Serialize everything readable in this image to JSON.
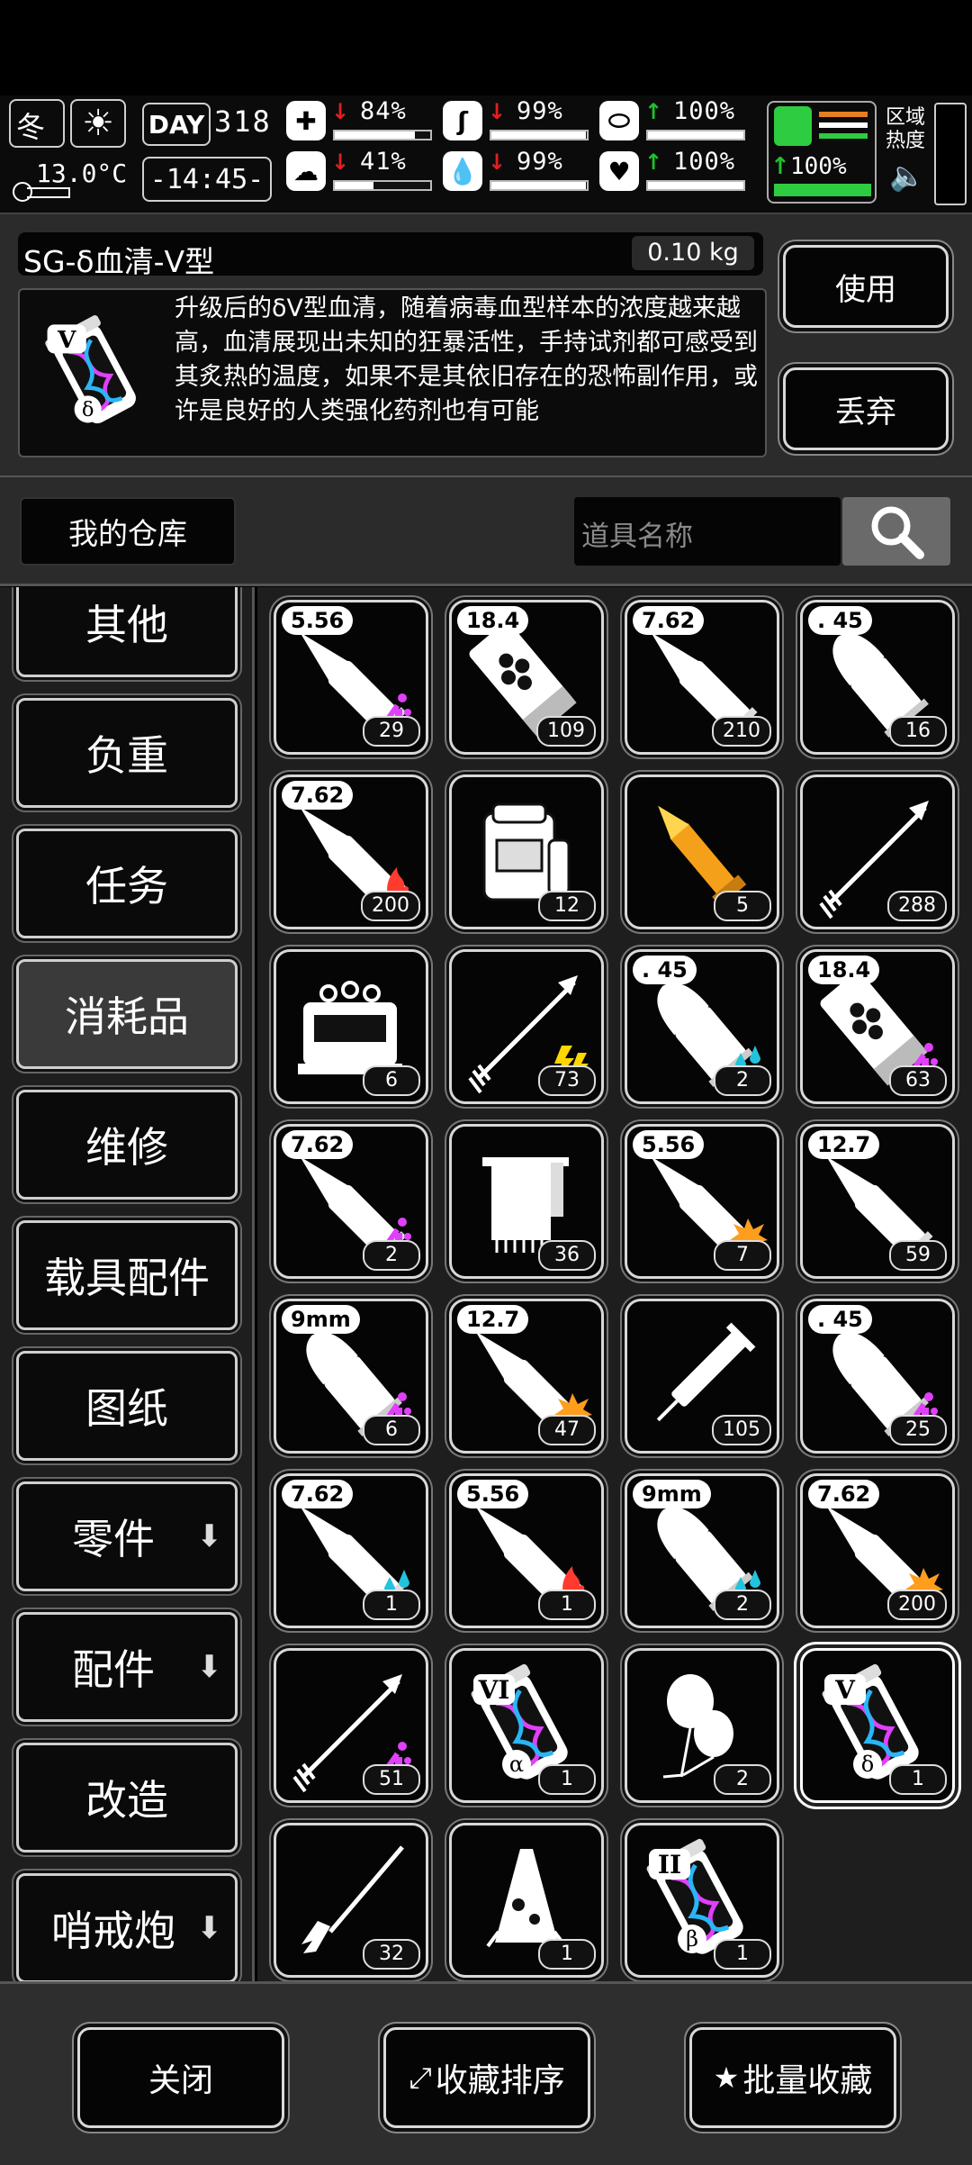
{
  "status_bar": {
    "season": "冬",
    "day_label": "DAY",
    "day_number": "318",
    "temperature": "13.0°C",
    "clock": "-14:45-",
    "stats": [
      {
        "name": "medical",
        "icon": "medkit-icon",
        "trend": "down",
        "value": "84%",
        "level": 0.84
      },
      {
        "name": "hunger",
        "icon": "stomach-icon",
        "trend": "down",
        "value": "99%",
        "level": 0.99
      },
      {
        "name": "vitamins",
        "icon": "pill-icon",
        "trend": "up",
        "value": "100%",
        "level": 1.0
      },
      {
        "name": "mood",
        "icon": "brain-icon",
        "trend": "down",
        "value": "41%",
        "level": 0.41
      },
      {
        "name": "thirst",
        "icon": "water-drop-icon",
        "trend": "down",
        "value": "99%",
        "level": 0.99
      },
      {
        "name": "health",
        "icon": "heart-icon",
        "trend": "up",
        "value": "100%",
        "level": 1.0
      }
    ],
    "stamina": {
      "trend": "up",
      "value": "100%",
      "level": 1.0
    },
    "area_heat_label": "区域\n热度",
    "colors": {
      "down": "#e0201f",
      "up": "#1ec22b",
      "stamina": "#2ecc40"
    }
  },
  "item_detail": {
    "name": "SG-δ血清-V型",
    "weight": "0.10 kg",
    "description": "升级后的δV型血清，随着病毒血型样本的浓度越来越高，血清展现出未知的狂暴活性，手持试剂都可感受到其炙热的温度，如果不是其依旧存在的恐怖副作用，或许是良好的人类强化药剂也有可能",
    "icon_badge": "V",
    "icon_greek": "δ",
    "use_label": "使用",
    "discard_label": "丢弃"
  },
  "storage": {
    "title": "我的仓库",
    "search_placeholder": "道具名称"
  },
  "categories": [
    {
      "label": "其他",
      "active": false,
      "has_arrow": false
    },
    {
      "label": "负重",
      "active": false,
      "has_arrow": false
    },
    {
      "label": "任务",
      "active": false,
      "has_arrow": false
    },
    {
      "label": "消耗品",
      "active": true,
      "has_arrow": false
    },
    {
      "label": "维修",
      "active": false,
      "has_arrow": false
    },
    {
      "label": "载具配件",
      "active": false,
      "has_arrow": false
    },
    {
      "label": "图纸",
      "active": false,
      "has_arrow": false
    },
    {
      "label": "零件",
      "active": false,
      "has_arrow": true
    },
    {
      "label": "配件",
      "active": false,
      "has_arrow": true
    },
    {
      "label": "改造",
      "active": false,
      "has_arrow": false
    },
    {
      "label": "哨戒炮",
      "active": false,
      "has_arrow": true
    }
  ],
  "items": [
    {
      "icon": "rifle-bullet-icon",
      "caliber": "5.56",
      "mod": "poison",
      "qty": "29"
    },
    {
      "icon": "shotgun-shell-icon",
      "caliber": "18.4",
      "mod": "",
      "qty": "109"
    },
    {
      "icon": "rifle-bullet-icon",
      "caliber": "7.62",
      "mod": "",
      "qty": "210"
    },
    {
      "icon": "pistol-bullet-icon",
      "caliber": ". 45",
      "mod": "",
      "qty": "16"
    },
    {
      "icon": "rifle-bullet-icon",
      "caliber": "7.62",
      "mod": "fire",
      "qty": "200"
    },
    {
      "icon": "backpack-icon",
      "caliber": "",
      "mod": "",
      "qty": "12"
    },
    {
      "icon": "rocket-icon",
      "caliber": "",
      "mod": "",
      "qty": "5"
    },
    {
      "icon": "arrow-icon",
      "caliber": "",
      "mod": "",
      "qty": "288"
    },
    {
      "icon": "machine-icon",
      "caliber": "",
      "mod": "",
      "qty": "6"
    },
    {
      "icon": "arrow-icon",
      "caliber": "",
      "mod": "shock",
      "qty": "73"
    },
    {
      "icon": "pistol-bullet-icon",
      "caliber": ". 45",
      "mod": "water",
      "qty": "2"
    },
    {
      "icon": "shotgun-shell-icon",
      "caliber": "18.4",
      "mod": "poison",
      "qty": "63"
    },
    {
      "icon": "rifle-bullet-icon",
      "caliber": "7.62",
      "mod": "poison",
      "qty": "2"
    },
    {
      "icon": "towel-icon",
      "caliber": "",
      "mod": "",
      "qty": "36"
    },
    {
      "icon": "rifle-bullet-icon",
      "caliber": "5.56",
      "mod": "explosive",
      "qty": "7"
    },
    {
      "icon": "rifle-bullet-icon",
      "caliber": "12.7",
      "mod": "",
      "qty": "59"
    },
    {
      "icon": "pistol-bullet-icon",
      "caliber": "9mm",
      "mod": "poison",
      "qty": "6"
    },
    {
      "icon": "rifle-bullet-icon",
      "caliber": "12.7",
      "mod": "explosive",
      "qty": "47"
    },
    {
      "icon": "syringe-icon",
      "caliber": "",
      "mod": "",
      "qty": "105"
    },
    {
      "icon": "pistol-bullet-icon",
      "caliber": ". 45",
      "mod": "poison",
      "qty": "25"
    },
    {
      "icon": "rifle-bullet-icon",
      "caliber": "7.62",
      "mod": "water",
      "qty": "1"
    },
    {
      "icon": "rifle-bullet-icon",
      "caliber": "5.56",
      "mod": "fire",
      "qty": "1"
    },
    {
      "icon": "pistol-bullet-icon",
      "caliber": "9mm",
      "mod": "water",
      "qty": "2"
    },
    {
      "icon": "rifle-bullet-icon",
      "caliber": "7.62",
      "mod": "explosive",
      "qty": "200"
    },
    {
      "icon": "arrow-icon",
      "caliber": "",
      "mod": "poison",
      "qty": "51"
    },
    {
      "icon": "serum-icon",
      "caliber": "",
      "mod": "",
      "badge": "VI",
      "greek": "α",
      "qty": "1"
    },
    {
      "icon": "balloon-icon",
      "caliber": "",
      "mod": "",
      "qty": "2"
    },
    {
      "icon": "serum-icon",
      "caliber": "",
      "mod": "",
      "badge": "V",
      "greek": "δ",
      "qty": "1",
      "selected": true
    },
    {
      "icon": "brush-icon",
      "caliber": "",
      "mod": "",
      "qty": "32"
    },
    {
      "icon": "flask-icon",
      "caliber": "",
      "mod": "",
      "qty": "1"
    },
    {
      "icon": "serum-icon",
      "caliber": "",
      "mod": "",
      "badge": "II",
      "greek": "β",
      "qty": "1"
    }
  ],
  "bottom_bar": {
    "close_label": "关闭",
    "sort_label": "收藏排序",
    "batch_label": "批量收藏"
  }
}
